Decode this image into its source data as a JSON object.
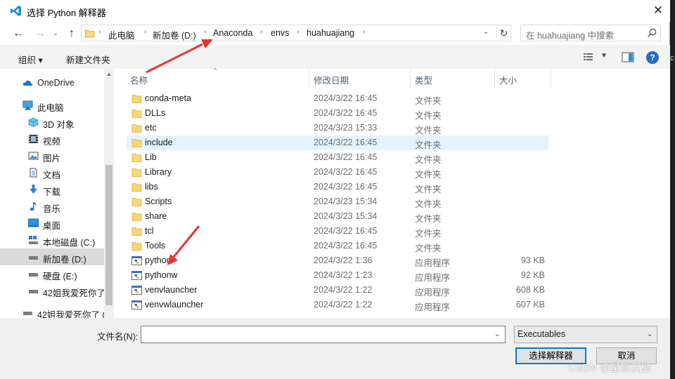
{
  "window": {
    "title": "选择 Python 解释器",
    "close_glyph": "✕"
  },
  "address": {
    "crumbs": [
      "此电脑",
      "新加卷 (D:)",
      "Anaconda",
      "envs",
      "huahuajiang"
    ]
  },
  "search": {
    "placeholder": "在 huahuajiang 中搜索"
  },
  "toolbar": {
    "organize_label": "组织 ▾",
    "new_folder_label": "新建文件夹",
    "help_label": "?"
  },
  "navpane": {
    "items": [
      {
        "label": "OneDrive",
        "icon": "cloud-icon"
      },
      {
        "label": "此电脑",
        "icon": "computer-icon"
      },
      {
        "label": "3D 对象",
        "icon": "3d-objects-icon"
      },
      {
        "label": "视频",
        "icon": "video-icon"
      },
      {
        "label": "图片",
        "icon": "picture-icon"
      },
      {
        "label": "文档",
        "icon": "document-icon"
      },
      {
        "label": "下载",
        "icon": "download-icon"
      },
      {
        "label": "音乐",
        "icon": "music-icon"
      },
      {
        "label": "桌面",
        "icon": "desktop-icon"
      },
      {
        "label": "本地磁盘 (C:)",
        "icon": "drive-icon"
      },
      {
        "label": "新加卷 (D:)",
        "icon": "drive-icon"
      },
      {
        "label": "硬盘 (E:)",
        "icon": "drive-icon"
      },
      {
        "label": "42姐我爱死你了",
        "icon": "drive-icon"
      },
      {
        "label": "42姐我爱死你了 (",
        "icon": "drive-icon"
      }
    ]
  },
  "filelist": {
    "columns": {
      "name": "名称",
      "date": "修改日期",
      "type": "类型",
      "size": "大小"
    },
    "rows": [
      {
        "name": "conda-meta",
        "date": "2024/3/22 16:45",
        "type": "文件夹",
        "size": "",
        "kind": "folder"
      },
      {
        "name": "DLLs",
        "date": "2024/3/22 16:45",
        "type": "文件夹",
        "size": "",
        "kind": "folder"
      },
      {
        "name": "etc",
        "date": "2024/3/23 15:33",
        "type": "文件夹",
        "size": "",
        "kind": "folder"
      },
      {
        "name": "include",
        "date": "2024/3/22 16:45",
        "type": "文件夹",
        "size": "",
        "kind": "folder"
      },
      {
        "name": "Lib",
        "date": "2024/3/22 16:45",
        "type": "文件夹",
        "size": "",
        "kind": "folder"
      },
      {
        "name": "Library",
        "date": "2024/3/22 16:45",
        "type": "文件夹",
        "size": "",
        "kind": "folder"
      },
      {
        "name": "libs",
        "date": "2024/3/22 16:45",
        "type": "文件夹",
        "size": "",
        "kind": "folder"
      },
      {
        "name": "Scripts",
        "date": "2024/3/23 15:34",
        "type": "文件夹",
        "size": "",
        "kind": "folder"
      },
      {
        "name": "share",
        "date": "2024/3/23 15:34",
        "type": "文件夹",
        "size": "",
        "kind": "folder"
      },
      {
        "name": "tcl",
        "date": "2024/3/22 16:45",
        "type": "文件夹",
        "size": "",
        "kind": "folder"
      },
      {
        "name": "Tools",
        "date": "2024/3/22 16:45",
        "type": "文件夹",
        "size": "",
        "kind": "folder"
      },
      {
        "name": "python",
        "date": "2024/3/22 1:36",
        "type": "应用程序",
        "size": "93 KB",
        "kind": "exe"
      },
      {
        "name": "pythonw",
        "date": "2024/3/22 1:23",
        "type": "应用程序",
        "size": "92 KB",
        "kind": "exe"
      },
      {
        "name": "venvlauncher",
        "date": "2024/3/22 1:22",
        "type": "应用程序",
        "size": "608 KB",
        "kind": "exe"
      },
      {
        "name": "venvwlauncher",
        "date": "2024/3/22 1:22",
        "type": "应用程序",
        "size": "607 KB",
        "kind": "exe"
      }
    ]
  },
  "bottom": {
    "filename_label": "文件名(N):",
    "filename_value": "",
    "filetype_value": "Executables",
    "select_label": "选择解释器",
    "cancel_label": "取消"
  },
  "watermark": "CSDN @星影沉璧",
  "background_edge_text": "c",
  "colors": {
    "accent": "#0078d7",
    "hover_row": "#e5f3ff",
    "selected_nav": "#d9d9d9",
    "annotation_arrow": "#e8352e",
    "folder": "#f8d775"
  }
}
